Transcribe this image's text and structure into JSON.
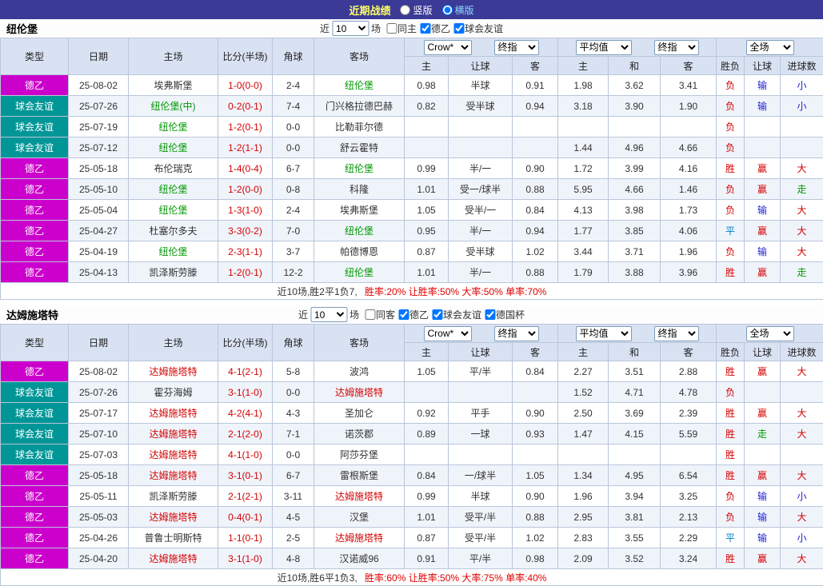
{
  "topbar": {
    "title": "近期战绩",
    "options": [
      {
        "label": "竖版",
        "selected": false
      },
      {
        "label": "横版",
        "selected": true
      }
    ]
  },
  "filter_shared": {
    "prefix": "近",
    "count": "10",
    "suffix": "场"
  },
  "columns": {
    "type": "类型",
    "date": "日期",
    "home": "主场",
    "score": "比分(半场)",
    "corner": "角球",
    "away": "客场",
    "asian_home": "主",
    "asian_handicap": "让球",
    "asian_away": "客",
    "avg_home": "主",
    "avg_draw": "和",
    "avg_away": "客",
    "res_wl": "胜负",
    "res_handicap": "让球",
    "res_goals": "进球数"
  },
  "selects": {
    "bookmaker": "Crow*",
    "final_asian": "终指",
    "average": "平均值",
    "final_avg": "终指",
    "full_match": "全场"
  },
  "colors": {
    "topbar_bg": "#3b3a97",
    "title_text": "#ffff66",
    "header_bg": "#d9e2f3",
    "alt_row_bg": "#eff4fb",
    "border": "#b9c6d9",
    "score_text": "#d50000",
    "stats_text": "#e00000",
    "type_colors": {
      "德乙": "#cc00cc",
      "球会友谊": "#009697"
    },
    "result_colors": {
      "胜": "#d50000",
      "负": "#d50000",
      "平": "#0080c0",
      "赢": "#d50000",
      "输": "#2020d0",
      "走": "#009900",
      "大": "#d50000",
      "小": "#2020d0"
    }
  },
  "tables": [
    {
      "team": "纽伦堡",
      "focus_color": "#009900",
      "filter": {
        "checkboxes": [
          {
            "label": "同主",
            "checked": false
          },
          {
            "label": "德乙",
            "checked": true
          },
          {
            "label": "球会友谊",
            "checked": true
          }
        ]
      },
      "rows": [
        {
          "type": "德乙",
          "date": "25-08-02",
          "home": "埃弗斯堡",
          "home_focus": false,
          "score": "1-0(0-0)",
          "corner": "2-4",
          "away": "纽伦堡",
          "away_focus": true,
          "asian_home": "0.98",
          "handicap": "半球",
          "asian_away": "0.91",
          "avg_home": "1.98",
          "avg_draw": "3.62",
          "avg_away": "3.41",
          "res_wl": "负",
          "res_handicap": "输",
          "res_goals": "小"
        },
        {
          "type": "球会友谊",
          "date": "25-07-26",
          "home": "纽伦堡(中)",
          "home_focus": true,
          "score": "0-2(0-1)",
          "corner": "7-4",
          "away": "门兴格拉德巴赫",
          "away_focus": false,
          "asian_home": "0.82",
          "handicap": "受半球",
          "asian_away": "0.94",
          "avg_home": "3.18",
          "avg_draw": "3.90",
          "avg_away": "1.90",
          "res_wl": "负",
          "res_handicap": "输",
          "res_goals": "小"
        },
        {
          "type": "球会友谊",
          "date": "25-07-19",
          "home": "纽伦堡",
          "home_focus": true,
          "score": "1-2(0-1)",
          "corner": "0-0",
          "away": "比勒菲尔德",
          "away_focus": false,
          "asian_home": "",
          "handicap": "",
          "asian_away": "",
          "avg_home": "",
          "avg_draw": "",
          "avg_away": "",
          "res_wl": "负",
          "res_handicap": "",
          "res_goals": ""
        },
        {
          "type": "球会友谊",
          "date": "25-07-12",
          "home": "纽伦堡",
          "home_focus": true,
          "score": "1-2(1-1)",
          "corner": "0-0",
          "away": "舒云霍特",
          "away_focus": false,
          "asian_home": "",
          "handicap": "",
          "asian_away": "",
          "avg_home": "1.44",
          "avg_draw": "4.96",
          "avg_away": "4.66",
          "res_wl": "负",
          "res_handicap": "",
          "res_goals": ""
        },
        {
          "type": "德乙",
          "date": "25-05-18",
          "home": "布伦瑞克",
          "home_focus": false,
          "score": "1-4(0-4)",
          "corner": "6-7",
          "away": "纽伦堡",
          "away_focus": true,
          "asian_home": "0.99",
          "handicap": "半/一",
          "asian_away": "0.90",
          "avg_home": "1.72",
          "avg_draw": "3.99",
          "avg_away": "4.16",
          "res_wl": "胜",
          "res_handicap": "赢",
          "res_goals": "大"
        },
        {
          "type": "德乙",
          "date": "25-05-10",
          "home": "纽伦堡",
          "home_focus": true,
          "score": "1-2(0-0)",
          "corner": "0-8",
          "away": "科隆",
          "away_focus": false,
          "asian_home": "1.01",
          "handicap": "受一/球半",
          "asian_away": "0.88",
          "avg_home": "5.95",
          "avg_draw": "4.66",
          "avg_away": "1.46",
          "res_wl": "负",
          "res_handicap": "赢",
          "res_goals": "走"
        },
        {
          "type": "德乙",
          "date": "25-05-04",
          "home": "纽伦堡",
          "home_focus": true,
          "score": "1-3(1-0)",
          "corner": "2-4",
          "away": "埃弗斯堡",
          "away_focus": false,
          "asian_home": "1.05",
          "handicap": "受半/一",
          "asian_away": "0.84",
          "avg_home": "4.13",
          "avg_draw": "3.98",
          "avg_away": "1.73",
          "res_wl": "负",
          "res_handicap": "输",
          "res_goals": "大"
        },
        {
          "type": "德乙",
          "date": "25-04-27",
          "home": "杜塞尔多夫",
          "home_focus": false,
          "score": "3-3(0-2)",
          "corner": "7-0",
          "away": "纽伦堡",
          "away_focus": true,
          "asian_home": "0.95",
          "handicap": "半/一",
          "asian_away": "0.94",
          "avg_home": "1.77",
          "avg_draw": "3.85",
          "avg_away": "4.06",
          "res_wl": "平",
          "res_handicap": "赢",
          "res_goals": "大"
        },
        {
          "type": "德乙",
          "date": "25-04-19",
          "home": "纽伦堡",
          "home_focus": true,
          "score": "2-3(1-1)",
          "corner": "3-7",
          "away": "帕德博恩",
          "away_focus": false,
          "asian_home": "0.87",
          "handicap": "受半球",
          "asian_away": "1.02",
          "avg_home": "3.44",
          "avg_draw": "3.71",
          "avg_away": "1.96",
          "res_wl": "负",
          "res_handicap": "输",
          "res_goals": "大"
        },
        {
          "type": "德乙",
          "date": "25-04-13",
          "home": "凯泽斯劳滕",
          "home_focus": false,
          "score": "1-2(0-1)",
          "corner": "12-2",
          "away": "纽伦堡",
          "away_focus": true,
          "asian_home": "1.01",
          "handicap": "半/一",
          "asian_away": "0.88",
          "avg_home": "1.79",
          "avg_draw": "3.88",
          "avg_away": "3.96",
          "res_wl": "胜",
          "res_handicap": "赢",
          "res_goals": "走"
        }
      ],
      "summary": {
        "prefix": "近10场,胜2平1负7,",
        "stats": "胜率:20% 让胜率:50% 大率:50% 单率:70%"
      }
    },
    {
      "team": "达姆施塔特",
      "focus_color": "#d50000",
      "filter": {
        "checkboxes": [
          {
            "label": "同客",
            "checked": false
          },
          {
            "label": "德乙",
            "checked": true
          },
          {
            "label": "球会友谊",
            "checked": true
          },
          {
            "label": "德国杯",
            "checked": true
          }
        ]
      },
      "rows": [
        {
          "type": "德乙",
          "date": "25-08-02",
          "home": "达姆施塔特",
          "home_focus": true,
          "score": "4-1(2-1)",
          "corner": "5-8",
          "away": "波鸿",
          "away_focus": false,
          "asian_home": "1.05",
          "handicap": "平/半",
          "asian_away": "0.84",
          "avg_home": "2.27",
          "avg_draw": "3.51",
          "avg_away": "2.88",
          "res_wl": "胜",
          "res_handicap": "赢",
          "res_goals": "大"
        },
        {
          "type": "球会友谊",
          "date": "25-07-26",
          "home": "霍芬海姆",
          "home_focus": false,
          "score": "3-1(1-0)",
          "corner": "0-0",
          "away": "达姆施塔特",
          "away_focus": true,
          "asian_home": "",
          "handicap": "",
          "asian_away": "",
          "avg_home": "1.52",
          "avg_draw": "4.71",
          "avg_away": "4.78",
          "res_wl": "负",
          "res_handicap": "",
          "res_goals": ""
        },
        {
          "type": "球会友谊",
          "date": "25-07-17",
          "home": "达姆施塔特",
          "home_focus": true,
          "score": "4-2(4-1)",
          "corner": "4-3",
          "away": "圣加仑",
          "away_focus": false,
          "asian_home": "0.92",
          "handicap": "平手",
          "asian_away": "0.90",
          "avg_home": "2.50",
          "avg_draw": "3.69",
          "avg_away": "2.39",
          "res_wl": "胜",
          "res_handicap": "赢",
          "res_goals": "大"
        },
        {
          "type": "球会友谊",
          "date": "25-07-10",
          "home": "达姆施塔特",
          "home_focus": true,
          "score": "2-1(2-0)",
          "corner": "7-1",
          "away": "诺茨郡",
          "away_focus": false,
          "asian_home": "0.89",
          "handicap": "一球",
          "asian_away": "0.93",
          "avg_home": "1.47",
          "avg_draw": "4.15",
          "avg_away": "5.59",
          "res_wl": "胜",
          "res_handicap": "走",
          "res_goals": "大"
        },
        {
          "type": "球会友谊",
          "date": "25-07-03",
          "home": "达姆施塔特",
          "home_focus": true,
          "score": "4-1(1-0)",
          "corner": "0-0",
          "away": "阿莎芬堡",
          "away_focus": false,
          "asian_home": "",
          "handicap": "",
          "asian_away": "",
          "avg_home": "",
          "avg_draw": "",
          "avg_away": "",
          "res_wl": "胜",
          "res_handicap": "",
          "res_goals": ""
        },
        {
          "type": "德乙",
          "date": "25-05-18",
          "home": "达姆施塔特",
          "home_focus": true,
          "score": "3-1(0-1)",
          "corner": "6-7",
          "away": "雷根斯堡",
          "away_focus": false,
          "asian_home": "0.84",
          "handicap": "一/球半",
          "asian_away": "1.05",
          "avg_home": "1.34",
          "avg_draw": "4.95",
          "avg_away": "6.54",
          "res_wl": "胜",
          "res_handicap": "赢",
          "res_goals": "大"
        },
        {
          "type": "德乙",
          "date": "25-05-11",
          "home": "凯泽斯劳滕",
          "home_focus": false,
          "score": "2-1(2-1)",
          "corner": "3-11",
          "away": "达姆施塔特",
          "away_focus": true,
          "asian_home": "0.99",
          "handicap": "半球",
          "asian_away": "0.90",
          "avg_home": "1.96",
          "avg_draw": "3.94",
          "avg_away": "3.25",
          "res_wl": "负",
          "res_handicap": "输",
          "res_goals": "小"
        },
        {
          "type": "德乙",
          "date": "25-05-03",
          "home": "达姆施塔特",
          "home_focus": true,
          "score": "0-4(0-1)",
          "corner": "4-5",
          "away": "汉堡",
          "away_focus": false,
          "asian_home": "1.01",
          "handicap": "受平/半",
          "asian_away": "0.88",
          "avg_home": "2.95",
          "avg_draw": "3.81",
          "avg_away": "2.13",
          "res_wl": "负",
          "res_handicap": "输",
          "res_goals": "大"
        },
        {
          "type": "德乙",
          "date": "25-04-26",
          "home": "普鲁士明斯特",
          "home_focus": false,
          "score": "1-1(0-1)",
          "corner": "2-5",
          "away": "达姆施塔特",
          "away_focus": true,
          "asian_home": "0.87",
          "handicap": "受平/半",
          "asian_away": "1.02",
          "avg_home": "2.83",
          "avg_draw": "3.55",
          "avg_away": "2.29",
          "res_wl": "平",
          "res_handicap": "输",
          "res_goals": "小"
        },
        {
          "type": "德乙",
          "date": "25-04-20",
          "home": "达姆施塔特",
          "home_focus": true,
          "score": "3-1(1-0)",
          "corner": "4-8",
          "away": "汉诺威96",
          "away_focus": false,
          "asian_home": "0.91",
          "handicap": "平/半",
          "asian_away": "0.98",
          "avg_home": "2.09",
          "avg_draw": "3.52",
          "avg_away": "3.24",
          "res_wl": "胜",
          "res_handicap": "赢",
          "res_goals": "大"
        }
      ],
      "summary": {
        "prefix": "近10场,胜6平1负3,",
        "stats": "胜率:60% 让胜率:50% 大率:75% 单率:40%"
      }
    }
  ]
}
